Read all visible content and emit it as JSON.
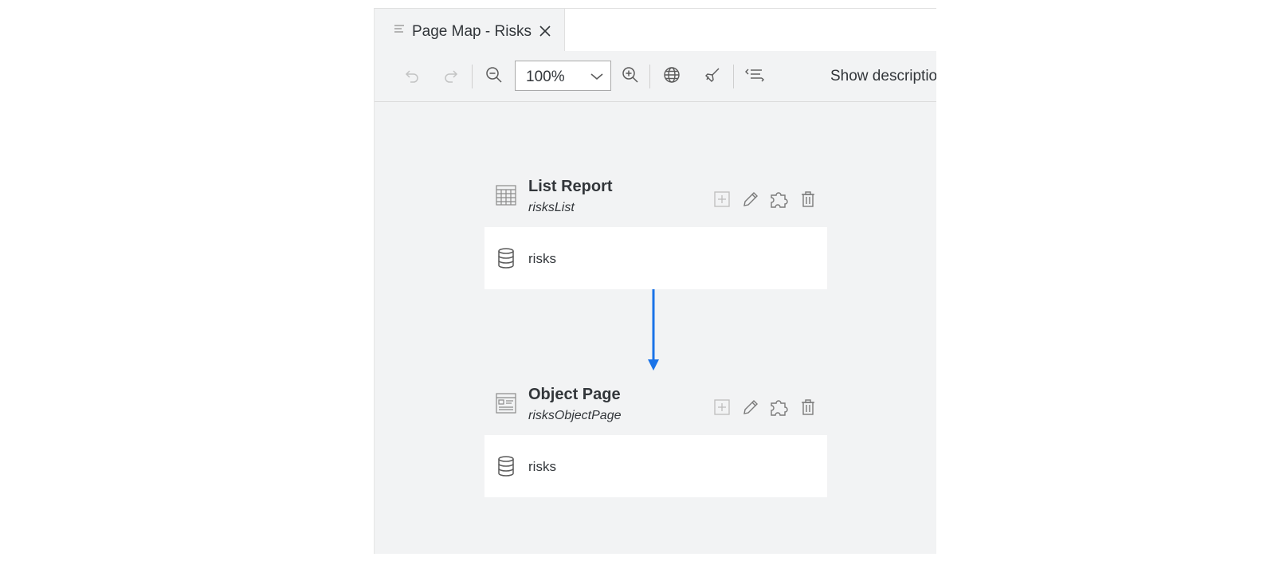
{
  "tab": {
    "label": "Page Map - Risks",
    "icon": "document-lines-icon"
  },
  "toolbar": {
    "zoom_value": "100%",
    "show_descriptions": "Show descriptio"
  },
  "pages": [
    {
      "type": "List Report",
      "id": "risksList",
      "entity": "risks",
      "icon": "table-view-icon"
    },
    {
      "type": "Object Page",
      "id": "risksObjectPage",
      "entity": "risks",
      "icon": "object-page-icon"
    }
  ],
  "colors": {
    "accent": "#1a73e8",
    "canvas": "#f2f3f4",
    "icon_muted": "#8a8a8a"
  }
}
